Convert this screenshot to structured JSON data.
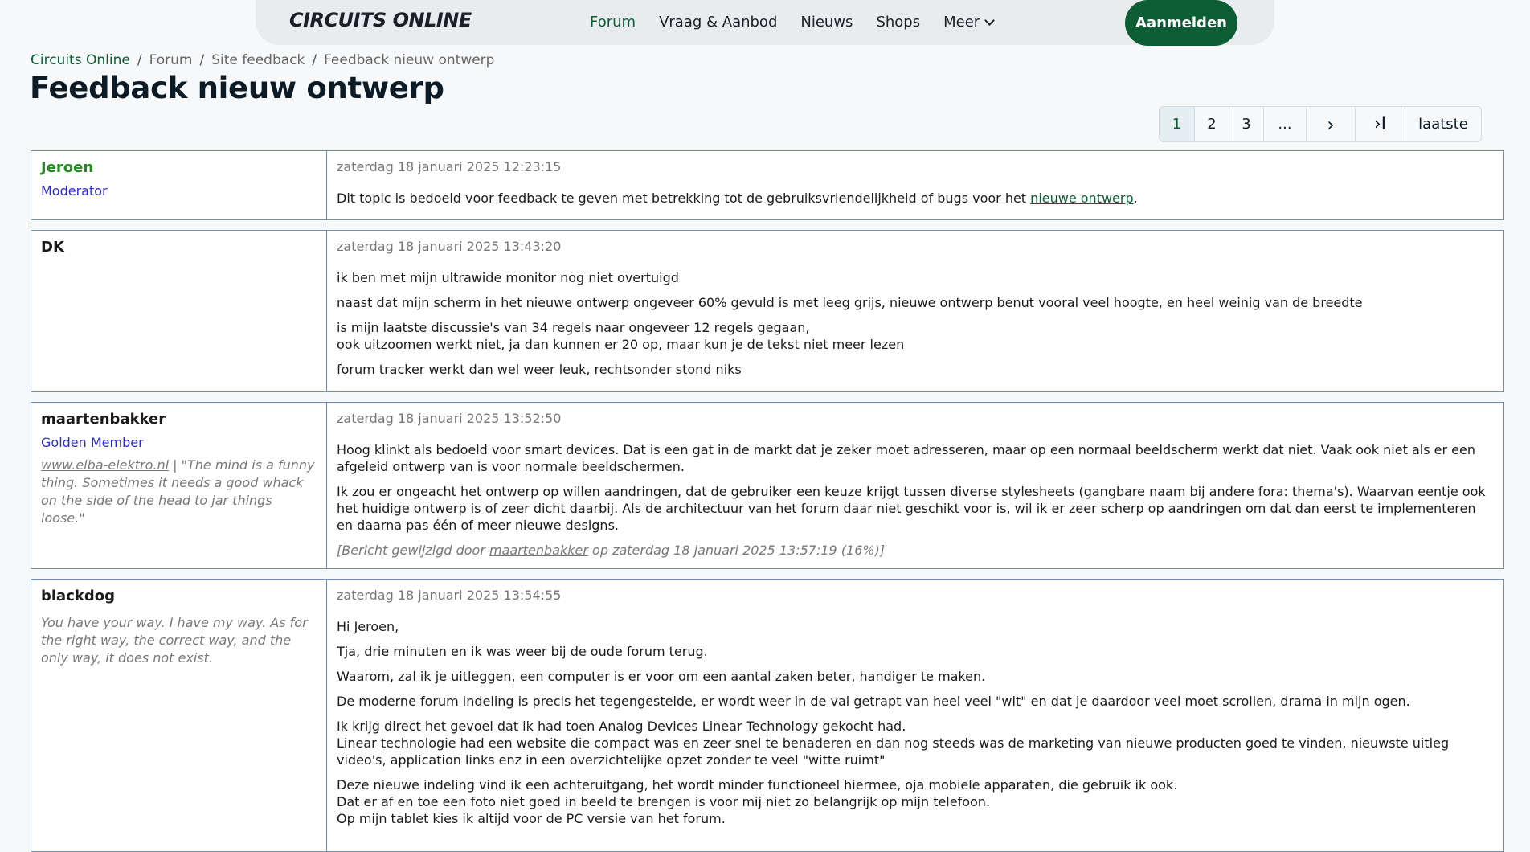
{
  "nav": {
    "logo": "CIRCUITS ONLINE",
    "links": [
      {
        "label": "Forum",
        "active": true
      },
      {
        "label": "Vraag & Aanbod"
      },
      {
        "label": "Nieuws"
      },
      {
        "label": "Shops"
      },
      {
        "label": "Meer"
      }
    ],
    "login": "Aanmelden"
  },
  "breadcrumb": [
    "Circuits Online",
    "Forum",
    "Site feedback",
    "Feedback nieuw ontwerp"
  ],
  "title": "Feedback nieuw ontwerp",
  "pagination": [
    "1",
    "2",
    "3",
    "...",
    "›",
    "›I",
    "laatste"
  ],
  "posts": [
    {
      "author": "Jeroen",
      "rank": "Moderator",
      "date": "zaterdag 18 januari 2025 12:23:15",
      "body_prefix": "Dit topic is bedoeld voor feedback te geven met betrekking tot de gebruiksvriendelijkheid of bugs voor het ",
      "body_link": "nieuwe ontwerp",
      "body_suffix": "."
    },
    {
      "author": "DK",
      "date": "zaterdag 18 januari 2025 13:43:20",
      "p1": "ik ben met mijn ultrawide monitor nog niet overtuigd",
      "p2": "naast dat mijn scherm in het nieuwe ontwerp ongeveer 60% gevuld is met leeg grijs, nieuwe ontwerp benut vooral veel hoogte, en heel weinig van de breedte",
      "p3a": "is mijn laatste discussie's van 34 regels naar ongeveer 12 regels gegaan,",
      "p3b": "ook uitzoomen werkt niet, ja dan kunnen er 20 op, maar kun je de tekst niet meer lezen",
      "p4": "forum tracker werkt dan wel weer leuk, rechtsonder stond niks"
    },
    {
      "author": "maartenbakker",
      "rank": "Golden Member",
      "sig_link": "www.elba-elektro.nl",
      "sig_text": " | \"The mind is a funny thing. Sometimes it needs a good whack on the side of the head to jar things loose.\"",
      "date": "zaterdag 18 januari 2025 13:52:50",
      "p1": "Hoog klinkt als bedoeld voor smart devices. Dat is een gat in de markt dat je zeker moet adresseren, maar op een normaal beeldscherm werkt dat niet. Vaak ook niet als er een afgeleid ontwerp van is voor normale beeldschermen.",
      "p2": "Ik zou er ongeacht het ontwerp op willen aandringen, dat de gebruiker een keuze krijgt tussen diverse stylesheets (gangbare naam bij andere fora: thema's). Waarvan eentje ook het huidige ontwerp is of zeer dicht daarbij. Als de architectuur van het forum daar niet geschikt voor is, wil ik er zeer scherp op aandringen om dat dan eerst te implementeren en daarna pas één of meer nieuwe designs.",
      "edit_prefix": "[Bericht gewijzigd door ",
      "edit_link": "maartenbakker",
      "edit_suffix": " op zaterdag 18 januari 2025 13:57:19 (16%)]"
    },
    {
      "author": "blackdog",
      "sig_text": "You have your way. I have my way. As for the right way, the correct way, and the only way, it does not exist.",
      "date": "zaterdag 18 januari 2025 13:54:55",
      "p1": "Hi Jeroen,",
      "p2": "Tja, drie minuten en ik was weer bij de oude forum terug.",
      "p3": "Waarom, zal ik je uitleggen, een computer is er voor om een aantal zaken beter, handiger te maken.",
      "p4": "De moderne forum indeling is precis het tegengestelde, er wordt weer in de val getrapt van heel veel \"wit\" en dat je daardoor veel moet scrollen, drama in mijn ogen.",
      "p5a": "Ik krijg direct het gevoel dat ik had toen Analog Devices Linear Technology gekocht had.",
      "p5b": "Linear technologie had een website die compact was en zeer snel te benaderen en dan nog steeds was de marketing van nieuwe producten goed te vinden, nieuwste uitleg video's, application links enz in een overzichtelijke opzet zonder te veel \"witte ruimt\"",
      "p6a": "Deze nieuwe indeling vind ik een achteruitgang, het wordt minder functioneel hiermee, oja mobiele apparaten, die gebruik ik ook.",
      "p6b": "Dat er af en toe een foto niet goed in beeld te brengen is voor mij niet zo belangrijk op mijn telefoon.",
      "p6c": "Op mijn tablet kies ik altijd voor de PC versie van het forum."
    }
  ]
}
